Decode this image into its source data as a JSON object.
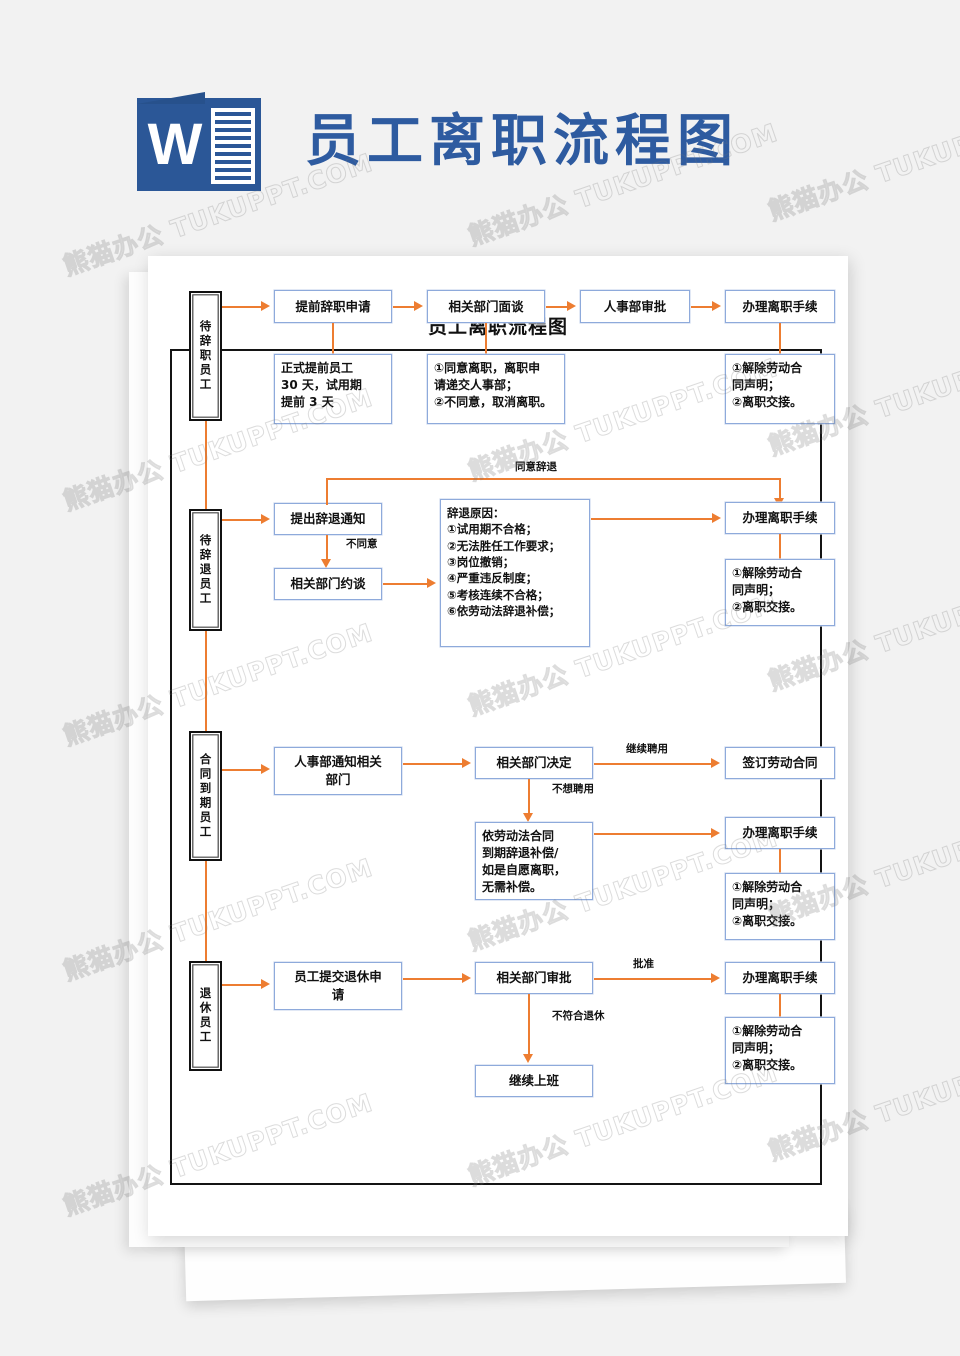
{
  "header": {
    "icon_name": "word-document-icon",
    "icon_letter": "W",
    "title": "员工离职流程图",
    "brand_blue": "#2b5797",
    "title_blue": "#2e5ba0"
  },
  "watermark": {
    "text": "熊猫办公 TUKUPPT.COM"
  },
  "document": {
    "title": "员工离职流程图",
    "accent_orange": "#ed7d31",
    "node_border_blue": "#8eaadb"
  },
  "flow": {
    "sections": [
      {
        "category": "待辞职员工",
        "steps": [
          {
            "label": "提前辞职申请"
          },
          {
            "label": "相关部门面谈"
          },
          {
            "label": "人事部审批"
          },
          {
            "label": "办理离职手续"
          }
        ],
        "details": [
          {
            "under": "提前辞职申请",
            "text": "正式提前员工\n30 天，试用期\n提前 3 天"
          },
          {
            "under": "相关部门面谈",
            "text": "①同意离职，离职申\n请递交人事部；\n②不同意，取消离职。"
          },
          {
            "under": "办理离职手续",
            "text": "①解除劳动合\n同声明；\n②离职交接。"
          }
        ]
      },
      {
        "category": "待辞退员工",
        "steps": [
          {
            "label": "提出辞退通知"
          },
          {
            "label": "相关部门约谈"
          },
          {
            "label": "办理离职手续"
          }
        ],
        "reasons_title": "辞退原因：",
        "reasons": [
          "①试用期不合格；",
          "②无法胜任工作要求；",
          "③岗位撤销；",
          "④严重违反制度；",
          "⑤考核连续不合格；",
          "⑥依劳动法辞退补偿；"
        ],
        "edge_labels": [
          "同意辞退",
          "不同意"
        ],
        "details": [
          {
            "under": "办理离职手续",
            "text": "①解除劳动合\n同声明；\n②离职交接。"
          }
        ]
      },
      {
        "category": "合同到期员工",
        "steps": [
          {
            "label": "人事部通知相关\n部门"
          },
          {
            "label": "相关部门决定"
          },
          {
            "label": "签订劳动合同"
          },
          {
            "label": "依劳动法合同\n到期辞退补偿/\n如是自愿离职，\n无需补偿。"
          },
          {
            "label": "办理离职手续"
          }
        ],
        "edge_labels": [
          "继续聘用",
          "不想聘用"
        ],
        "details": [
          {
            "under": "办理离职手续",
            "text": "①解除劳动合\n同声明；\n②离职交接。"
          }
        ]
      },
      {
        "category": "退休员工",
        "steps": [
          {
            "label": "员工提交退休申\n请"
          },
          {
            "label": "相关部门审批"
          },
          {
            "label": "办理离职手续"
          },
          {
            "label": "继续上班"
          }
        ],
        "edge_labels": [
          "批准",
          "不符合退休"
        ],
        "details": [
          {
            "under": "办理离职手续",
            "text": "①解除劳动合\n同声明；\n②离职交接。"
          }
        ]
      }
    ]
  }
}
